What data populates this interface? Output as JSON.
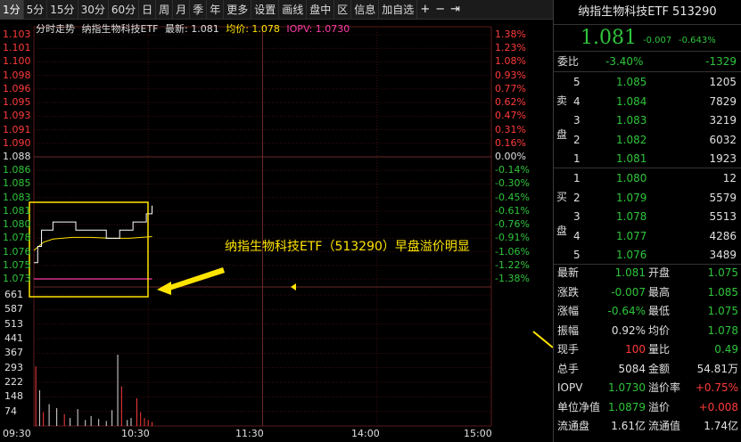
{
  "toolbar": {
    "items": [
      "1分",
      "5分",
      "15分",
      "30分",
      "60分",
      "日",
      "周",
      "月",
      "季",
      "年",
      "更多",
      "设置",
      "画线",
      "盘中",
      "区",
      "信息",
      "加自选"
    ],
    "active_index": 0,
    "icons": [
      "plus-icon",
      "minus-icon",
      "exit-icon"
    ],
    "icon_glyphs": [
      "+",
      "−",
      "⇥"
    ]
  },
  "chart": {
    "title_label": "分时走势",
    "name": "纳指生物科技ETF",
    "latest_label": "最新: 1.081",
    "avg_label": "均价: 1.078",
    "iopv_label": "IOPV: 1.0730"
  },
  "annotation": "纳指生物科技ETF（513290）早盘溢价明显",
  "colors": {
    "up": "#ff3b3b",
    "down": "#2fc43b",
    "avg": "#ffe400",
    "iopv": "#ff3ca8",
    "highlight": "#ffe400"
  },
  "chart_data": {
    "type": "line",
    "price_ticks": [
      {
        "label": "1.103",
        "pct": "1.38%",
        "dir": "up"
      },
      {
        "label": "1.101",
        "pct": "1.23%",
        "dir": "up"
      },
      {
        "label": "1.100",
        "pct": "1.08%",
        "dir": "up"
      },
      {
        "label": "1.098",
        "pct": "0.93%",
        "dir": "up"
      },
      {
        "label": "1.096",
        "pct": "0.77%",
        "dir": "up"
      },
      {
        "label": "1.095",
        "pct": "0.62%",
        "dir": "up"
      },
      {
        "label": "1.093",
        "pct": "0.47%",
        "dir": "up"
      },
      {
        "label": "1.091",
        "pct": "0.31%",
        "dir": "up"
      },
      {
        "label": "1.090",
        "pct": "0.16%",
        "dir": "up"
      },
      {
        "label": "1.088",
        "pct": "0.00%",
        "dir": "flat"
      },
      {
        "label": "1.086",
        "pct": "-0.14%",
        "dir": "down"
      },
      {
        "label": "1.085",
        "pct": "-0.30%",
        "dir": "down"
      },
      {
        "label": "1.083",
        "pct": "-0.45%",
        "dir": "down"
      },
      {
        "label": "1.081",
        "pct": "-0.61%",
        "dir": "down"
      },
      {
        "label": "1.080",
        "pct": "-0.76%",
        "dir": "down"
      },
      {
        "label": "1.078",
        "pct": "-0.91%",
        "dir": "down"
      },
      {
        "label": "1.076",
        "pct": "-1.06%",
        "dir": "down"
      },
      {
        "label": "1.075",
        "pct": "-1.22%",
        "dir": "down"
      },
      {
        "label": "1.073",
        "pct": "-1.38%",
        "dir": "down"
      }
    ],
    "ylim": [
      1.073,
      1.103
    ],
    "volume_ticks": [
      "661",
      "587",
      "513",
      "441",
      "367",
      "293",
      "222",
      "148",
      "74"
    ],
    "volume_max": 661,
    "x_ticks": [
      "09:30",
      "10:30",
      "11:30",
      "14:00",
      "15:00"
    ],
    "total_minutes": 240,
    "series": [
      {
        "minutes": [
          0,
          2,
          4,
          7,
          10,
          14,
          18,
          22,
          26,
          30,
          34,
          38,
          42,
          45,
          47,
          50,
          52,
          55,
          57,
          59,
          60,
          62
        ],
        "values": [
          1.075,
          1.077,
          1.079,
          1.079,
          1.08,
          1.08,
          1.08,
          1.079,
          1.079,
          1.079,
          1.079,
          1.078,
          1.078,
          1.079,
          1.079,
          1.079,
          1.08,
          1.08,
          1.08,
          1.081,
          1.081,
          1.082
        ]
      },
      {
        "minutes": [
          0,
          5,
          10,
          20,
          30,
          40,
          50,
          62
        ],
        "values": [
          1.0765,
          1.0775,
          1.0779,
          1.0781,
          1.0781,
          1.078,
          1.078,
          1.0782
        ]
      },
      {
        "minutes": [
          0,
          62
        ],
        "values": [
          1.073,
          1.073
        ]
      }
    ],
    "volume": [
      {
        "minute": 1,
        "value": 300,
        "dir": "up"
      },
      {
        "minute": 3,
        "value": 180,
        "dir": "down"
      },
      {
        "minute": 5,
        "value": 70,
        "dir": "up"
      },
      {
        "minute": 8,
        "value": 110,
        "dir": "down"
      },
      {
        "minute": 12,
        "value": 90,
        "dir": "down"
      },
      {
        "minute": 16,
        "value": 60,
        "dir": "up"
      },
      {
        "minute": 19,
        "value": 40,
        "dir": "down"
      },
      {
        "minute": 23,
        "value": 85,
        "dir": "down"
      },
      {
        "minute": 27,
        "value": 30,
        "dir": "down"
      },
      {
        "minute": 30,
        "value": 50,
        "dir": "down"
      },
      {
        "minute": 34,
        "value": 35,
        "dir": "down"
      },
      {
        "minute": 38,
        "value": 25,
        "dir": "down"
      },
      {
        "minute": 41,
        "value": 80,
        "dir": "down"
      },
      {
        "minute": 44,
        "value": 360,
        "dir": "down"
      },
      {
        "minute": 46,
        "value": 200,
        "dir": "up"
      },
      {
        "minute": 49,
        "value": 30,
        "dir": "down"
      },
      {
        "minute": 51,
        "value": 40,
        "dir": "down"
      },
      {
        "minute": 54,
        "value": 140,
        "dir": "up"
      },
      {
        "minute": 56,
        "value": 70,
        "dir": "up"
      },
      {
        "minute": 58,
        "value": 40,
        "dir": "up"
      },
      {
        "minute": 60,
        "value": 30,
        "dir": "up"
      },
      {
        "minute": 62,
        "value": 20,
        "dir": "up"
      }
    ]
  },
  "panel": {
    "title": "纳指生物科技ETF 513290",
    "price": "1.081",
    "change": "-0.007",
    "change_pct": "-0.643%",
    "weibi_label": "委比",
    "weibi_pct": "-3.40%",
    "weibi_val": "-1329",
    "sell_label": [
      "卖",
      "盘"
    ],
    "buy_label": [
      "买",
      "盘"
    ],
    "asks": [
      {
        "level": "5",
        "price": "1.085",
        "vol": "1205"
      },
      {
        "level": "4",
        "price": "1.084",
        "vol": "7829"
      },
      {
        "level": "3",
        "price": "1.083",
        "vol": "3219"
      },
      {
        "level": "2",
        "price": "1.082",
        "vol": "6032"
      },
      {
        "level": "1",
        "price": "1.081",
        "vol": "1923"
      }
    ],
    "bids": [
      {
        "level": "1",
        "price": "1.080",
        "vol": "12"
      },
      {
        "level": "2",
        "price": "1.079",
        "vol": "5579"
      },
      {
        "level": "3",
        "price": "1.078",
        "vol": "5513"
      },
      {
        "level": "4",
        "price": "1.077",
        "vol": "4286"
      },
      {
        "level": "5",
        "price": "1.076",
        "vol": "3489"
      }
    ],
    "stats": [
      {
        "k1": "最新",
        "v1": "1.081",
        "c1": "down",
        "k2": "开盘",
        "v2": "1.075",
        "c2": "down"
      },
      {
        "k1": "涨跌",
        "v1": "-0.007",
        "c1": "down",
        "k2": "最高",
        "v2": "1.085",
        "c2": "down"
      },
      {
        "k1": "涨幅",
        "v1": "-0.64%",
        "c1": "down",
        "k2": "最低",
        "v2": "1.075",
        "c2": "down"
      },
      {
        "k1": "振幅",
        "v1": "0.92%",
        "c1": "white",
        "k2": "均价",
        "v2": "1.078",
        "c2": "down"
      },
      {
        "k1": "现手",
        "v1": "100",
        "c1": "up",
        "k2": "量比",
        "v2": "0.49",
        "c2": "down"
      },
      {
        "k1": "总手",
        "v1": "5084",
        "c1": "white",
        "k2": "金额",
        "v2": "54.81万",
        "c2": "white"
      },
      {
        "k1": "IOPV",
        "v1": "1.0730",
        "c1": "down",
        "k2": "溢价率",
        "v2": "+0.75%",
        "c2": "up"
      },
      {
        "k1": "单位净值",
        "v1": "1.0879",
        "c1": "down",
        "k2": "溢价",
        "v2": "+0.008",
        "c2": "up"
      },
      {
        "k1": "流通盘",
        "v1": "1.61亿",
        "c1": "white",
        "k2": "流通值",
        "v2": "1.74亿",
        "c2": "white"
      }
    ]
  }
}
